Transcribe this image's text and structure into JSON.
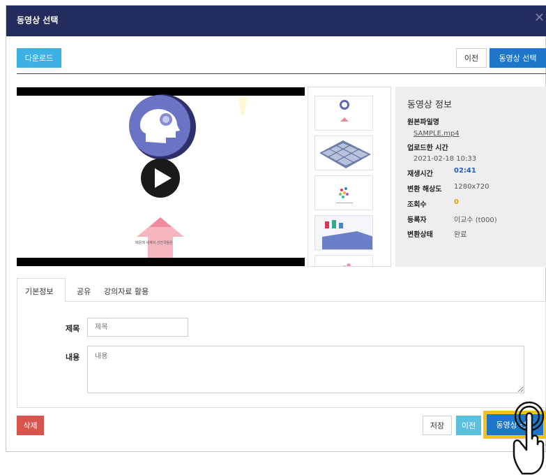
{
  "dialog": {
    "title": "동영상 선택",
    "close_glyph": "✕"
  },
  "toolbar": {
    "download_label": "다운로드",
    "prev_label": "이전",
    "select_label": "동영상 선택"
  },
  "video": {
    "caption": "때문에 세계의 선진국들은"
  },
  "info": {
    "heading": "동영상 정보",
    "filename_label": "원본파일명",
    "filename": "SAMPLE.mp4",
    "upload_label": "업로드한 시간",
    "upload_time": "2021-02-18 10:33",
    "duration_label": "재생시간",
    "duration": "02:41",
    "resolution_label": "변환 해상도",
    "resolution": "1280x720",
    "views_label": "조회수",
    "views": "0",
    "registrant_label": "등록자",
    "registrant": "이교수 (t000)",
    "status_label": "변환상태",
    "status": "완료"
  },
  "tabs": [
    {
      "label": "기본정보"
    },
    {
      "label": "공유"
    },
    {
      "label": "강의자료 활용"
    }
  ],
  "form": {
    "title_label": "제목",
    "title_placeholder": "제목",
    "content_label": "내용",
    "content_placeholder": "내용"
  },
  "footer": {
    "delete_label": "삭제",
    "save_label": "저장",
    "prev_label": "이전",
    "select_label": "동영상 선택"
  },
  "colors": {
    "header_bg": "#242c5e",
    "download": "#3fb0e3",
    "select": "#1e76c8",
    "delete": "#d9534f",
    "prev": "#5bc0de",
    "duration": "#1e5fc8",
    "views": "#e8a000",
    "highlight": "#f2c21b"
  }
}
